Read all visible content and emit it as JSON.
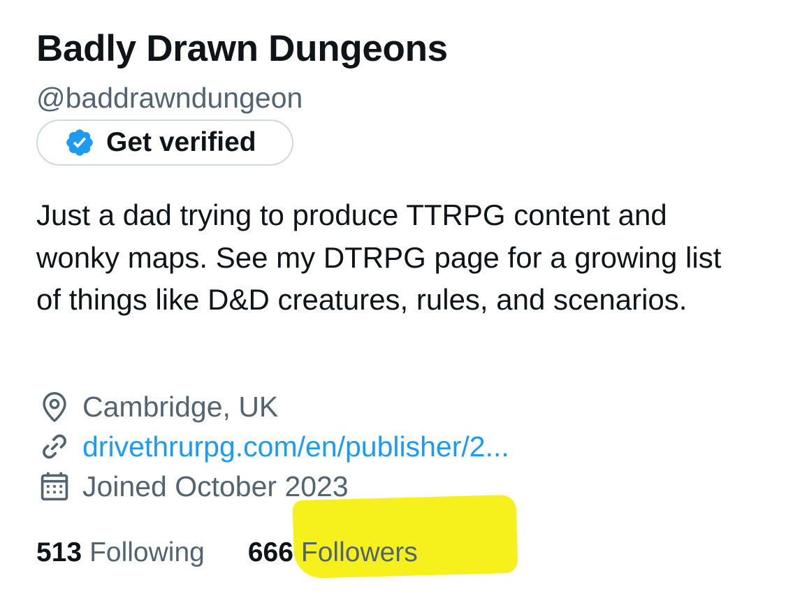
{
  "profile": {
    "display_name": "Badly Drawn Dungeons",
    "handle": "@baddrawndungeon",
    "verify_button": {
      "label": "Get verified",
      "icon": "verified-badge-icon",
      "icon_color": "#1d9bf0"
    },
    "bio": "Just a dad trying to produce TTRPG content and wonky maps. See my DTRPG page for a growing list of things like D&D creatures, rules, and scenarios.",
    "location": {
      "icon": "location-pin-icon",
      "text": "Cambridge, UK"
    },
    "website": {
      "icon": "link-icon",
      "text": "drivethrurpg.com/en/publisher/2..."
    },
    "joined": {
      "icon": "calendar-icon",
      "text": "Joined October 2023"
    },
    "stats": {
      "following": {
        "count": "513",
        "label": "Following"
      },
      "followers": {
        "count": "666",
        "label": "Followers",
        "highlight_color": "#f6f010"
      }
    }
  },
  "colors": {
    "primary_text": "#0f1419",
    "secondary_text": "#536471",
    "link": "#1d9bf0",
    "border": "#cfd9de"
  }
}
